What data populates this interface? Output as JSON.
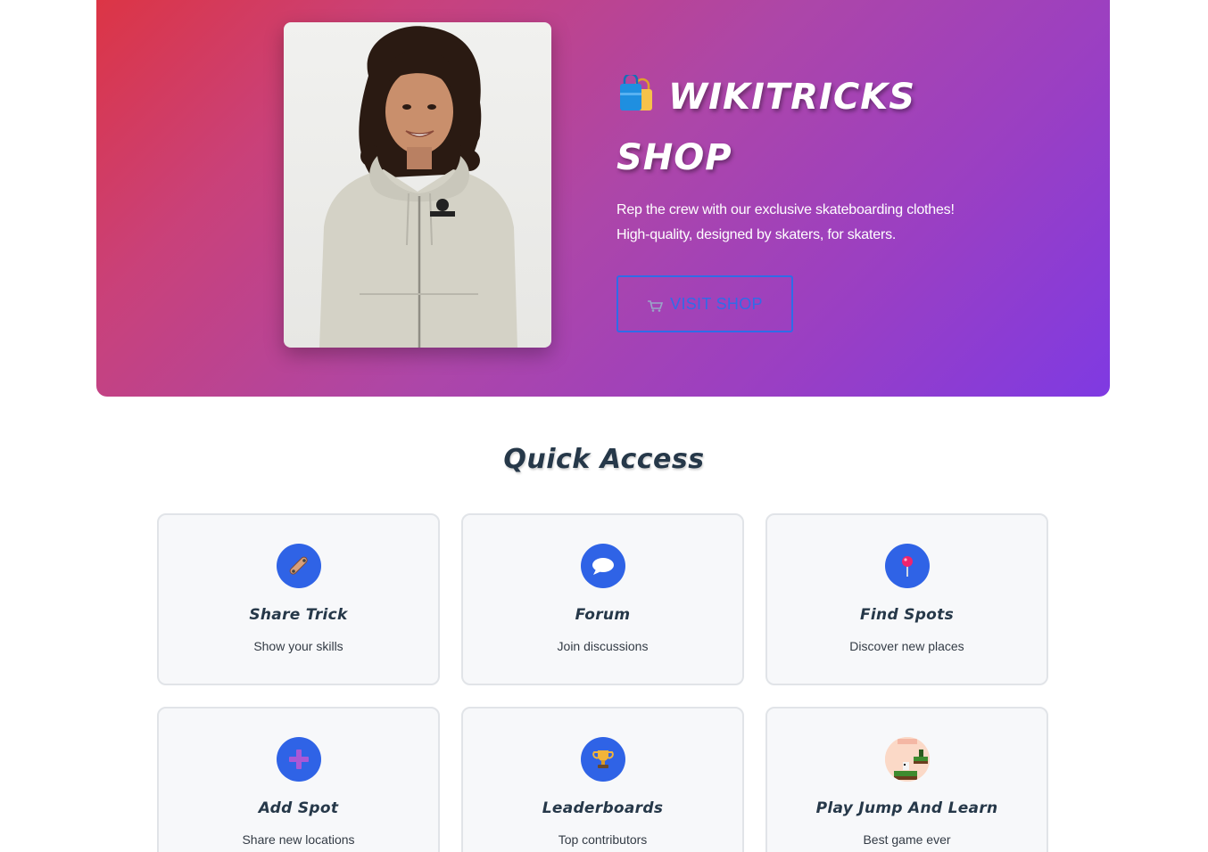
{
  "shop": {
    "title": "Wikitricks Shop",
    "description_line1": "Rep the crew with our exclusive skateboarding clothes!",
    "description_line2": "High-quality, designed by skaters, for skaters.",
    "button_label": "VISIT SHOP",
    "button_icon": "cart-icon",
    "title_icon": "shopping-bags-icon",
    "image": "model-wearing-wikitricks-hoodie",
    "gradient_colors": [
      "#dc3545",
      "#ad46a8",
      "#7f3ae2"
    ]
  },
  "quick_access": {
    "title": "Quick Access",
    "cards": [
      {
        "title": "Share Trick",
        "subtitle": "Show your skills",
        "icon": "skateboard-icon"
      },
      {
        "title": "Forum",
        "subtitle": "Join discussions",
        "icon": "speech-bubble-icon"
      },
      {
        "title": "Find Spots",
        "subtitle": "Discover new places",
        "icon": "map-pin-icon"
      },
      {
        "title": "Add Spot",
        "subtitle": "Share new locations",
        "icon": "plus-icon"
      },
      {
        "title": "Leaderboards",
        "subtitle": "Top contributors",
        "icon": "trophy-icon"
      },
      {
        "title": "Play Jump And Learn",
        "subtitle": "Best game ever",
        "icon": "pixel-game-icon"
      }
    ]
  },
  "colors": {
    "accent": "#2f63e6",
    "heading": "#263849",
    "card_bg": "#f7f8fa",
    "card_border": "#e1e4e8"
  }
}
